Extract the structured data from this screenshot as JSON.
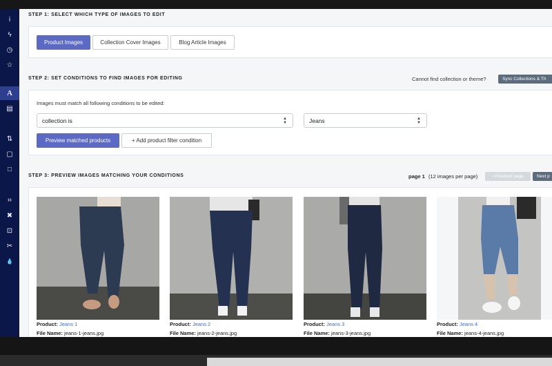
{
  "sidebar": {
    "icons": [
      "info-icon",
      "bolt-icon",
      "clock-icon",
      "star-icon",
      "font-icon",
      "document-icon",
      "sort-icon",
      "file-icon",
      "square-icon",
      "crop-icon",
      "compress-icon",
      "screen-icon",
      "scissors-icon",
      "drop-icon"
    ],
    "glyphs": [
      "i",
      "ϟ",
      "◷",
      "☆",
      "A",
      "▤",
      "⇅",
      "▢",
      "□",
      "⌗",
      "✖",
      "⊡",
      "✂",
      "💧"
    ]
  },
  "step1": {
    "title": "STEP 1: SELECT WHICH TYPE OF IMAGES TO EDIT",
    "buttons": [
      "Product Images",
      "Collection Cover Images",
      "Blog Article Images"
    ]
  },
  "step2": {
    "title": "STEP 2: SET CONDITIONS TO FIND IMAGES FOR EDITING",
    "help_text": "Cannot find collection or theme?",
    "sync_label": "Sync Collections & Th",
    "match_label": "Images must match all following conditions to be edited:",
    "condition_field": "collection is",
    "condition_value": "Jeans",
    "preview_label": "Preview matched products",
    "add_filter_label": "+ Add product filter condition"
  },
  "step3": {
    "title": "STEP 3: PREVIEW IMAGES MATCHING YOUR CONDITIONS",
    "page_label": "page 1",
    "per_page": "(12 images per page)",
    "prev_label": "‹ Previous page",
    "next_label": "Next p"
  },
  "products": [
    {
      "product_label": "Product:",
      "name": "Jeans 1",
      "file_label": "File Name:",
      "file": "jeans-1-jeans.jpg"
    },
    {
      "product_label": "Product:",
      "name": "Jeans 2",
      "file_label": "File Name:",
      "file": "jeans-2-jeans.jpg"
    },
    {
      "product_label": "Product:",
      "name": "Jeans 3",
      "file_label": "File Name:",
      "file": "jeans-3-jeans.jpg"
    },
    {
      "product_label": "Product:",
      "name": "Jeans 4",
      "file_label": "File Name:",
      "file": "jeans-4-jeans.jpg"
    }
  ]
}
